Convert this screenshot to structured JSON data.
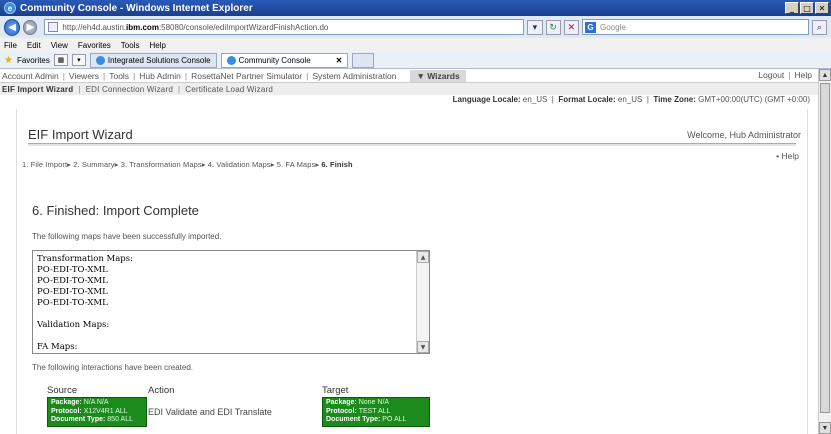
{
  "browser": {
    "window_title": "Community Console - Windows Internet Explorer",
    "url_prefix": "http://eh4d.austin.",
    "url_domain": "ibm.com",
    "url_suffix": ":58080/console/ediImportWizardFinishAction.do",
    "search_placeholder": "Google",
    "menu": [
      "File",
      "Edit",
      "View",
      "Favorites",
      "Tools",
      "Help"
    ],
    "favorites_label": "Favorites",
    "tabs": [
      {
        "label": "Integrated Solutions Console"
      },
      {
        "label": "Community Console"
      }
    ]
  },
  "topnav": {
    "items": [
      "Account Admin",
      "Viewers",
      "Tools",
      "Hub Admin",
      "RosettaNet Partner Simulator",
      "System Administration"
    ],
    "wizards_label": "▼ Wizards",
    "logout": "Logout",
    "help": "Help"
  },
  "subnav": {
    "items": [
      "EIF Import Wizard",
      "EDI Connection Wizard",
      "Certificate Load Wizard"
    ]
  },
  "locale": {
    "language_label": "Language Locale:",
    "language_value": "en_US",
    "format_label": "Format Locale:",
    "format_value": "en_US",
    "timezone_label": "Time Zone:",
    "timezone_value": "GMT+00:00(UTC) (GMT +0:00)"
  },
  "wizard": {
    "title": "EIF Import Wizard",
    "welcome": "Welcome, Hub Administrator",
    "help": "Help",
    "steps": [
      "1. File Import",
      "2. Summary",
      "3. Transformation Maps",
      "4. Validation Maps",
      "5. FA Maps"
    ],
    "current_step": "6. Finish"
  },
  "result": {
    "section_title": "6. Finished: Import Complete",
    "intro": "The following maps have been successfully imported.",
    "maps_lines": [
      "Transformation Maps:",
      "PO-EDI-TO-XML",
      "PO-EDI-TO-XML",
      "PO-EDI-TO-XML",
      "PO-EDI-TO-XML",
      "",
      "Validation Maps:",
      "",
      "FA Maps:"
    ],
    "interactions_intro": "The following interactions have been created."
  },
  "interactions_table": {
    "headers": {
      "source": "Source",
      "action": "Action",
      "target": "Target"
    },
    "row": {
      "source": {
        "package_label": "Package:",
        "package_value": "N/A N/A",
        "protocol_label": "Protocol:",
        "protocol_value": "X12V4R1 ALL",
        "doctype_label": "Document Type:",
        "doctype_value": "850 ALL"
      },
      "action": "EDI Validate and EDI Translate",
      "target": {
        "package_label": "Package:",
        "package_value": "None N/A",
        "protocol_label": "Protocol:",
        "protocol_value": "TEST ALL",
        "doctype_label": "Document Type:",
        "doctype_value": "PO ALL"
      }
    }
  }
}
